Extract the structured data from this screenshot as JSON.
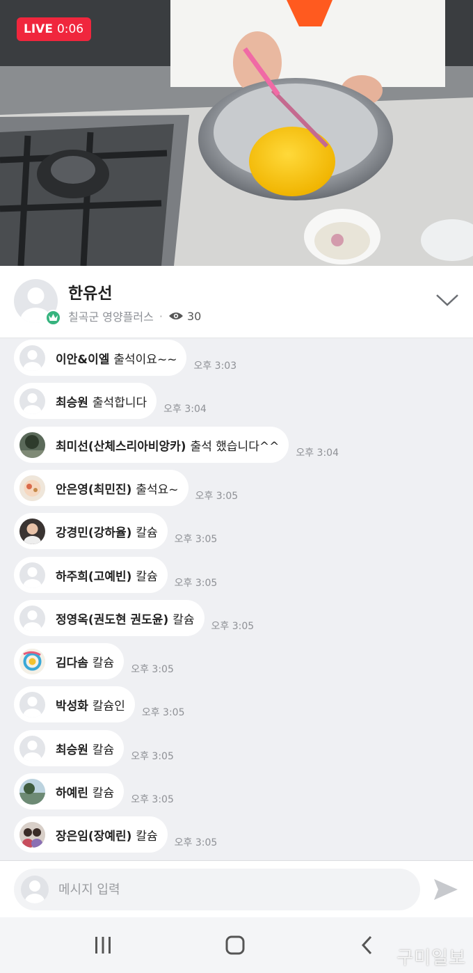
{
  "live": {
    "badge": "LIVE",
    "elapsed": "0:06"
  },
  "host": {
    "name": "한유선",
    "channel": "칠곡군 영양플러스",
    "separator": "·",
    "viewer_count": "30"
  },
  "messages": [
    {
      "nick": "이안&이엘",
      "text": "출석이요~~",
      "time": "오후 3:03",
      "avatar": "default"
    },
    {
      "nick": "최승원",
      "text": "출석합니다",
      "time": "오후 3:04",
      "avatar": "default"
    },
    {
      "nick": "최미선(산체스리아비앙카)",
      "text": "출석 했습니다^^",
      "time": "오후 3:04",
      "avatar": "photo-tree"
    },
    {
      "nick": "안은영(최민진)",
      "text": "출석요~",
      "time": "오후 3:05",
      "avatar": "photo-food"
    },
    {
      "nick": "강경민(강하율)",
      "text": "칼슘",
      "time": "오후 3:05",
      "avatar": "photo-person"
    },
    {
      "nick": "하주희(고예빈)",
      "text": "칼슘",
      "time": "오후 3:05",
      "avatar": "default"
    },
    {
      "nick": "정영옥(권도현 권도윤)",
      "text": "칼슘",
      "time": "오후 3:05",
      "avatar": "default"
    },
    {
      "nick": "김다솜",
      "text": "칼슘",
      "time": "오후 3:05",
      "avatar": "photo-swirl"
    },
    {
      "nick": "박성화",
      "text": "칼슘인",
      "time": "오후 3:05",
      "avatar": "default"
    },
    {
      "nick": "최승원",
      "text": "칼슘",
      "time": "오후 3:05",
      "avatar": "default"
    },
    {
      "nick": "하예린",
      "text": "칼슘",
      "time": "오후 3:05",
      "avatar": "photo-lake"
    },
    {
      "nick": "장은임(장예린)",
      "text": "칼슘",
      "time": "오후 3:05",
      "avatar": "photo-family"
    }
  ],
  "composer": {
    "placeholder": "메시지 입력",
    "value": ""
  },
  "watermark": "구미일보",
  "colors": {
    "live_red": "#f0263d",
    "crown_green": "#36b37e",
    "chat_bg": "#eff0f3"
  }
}
